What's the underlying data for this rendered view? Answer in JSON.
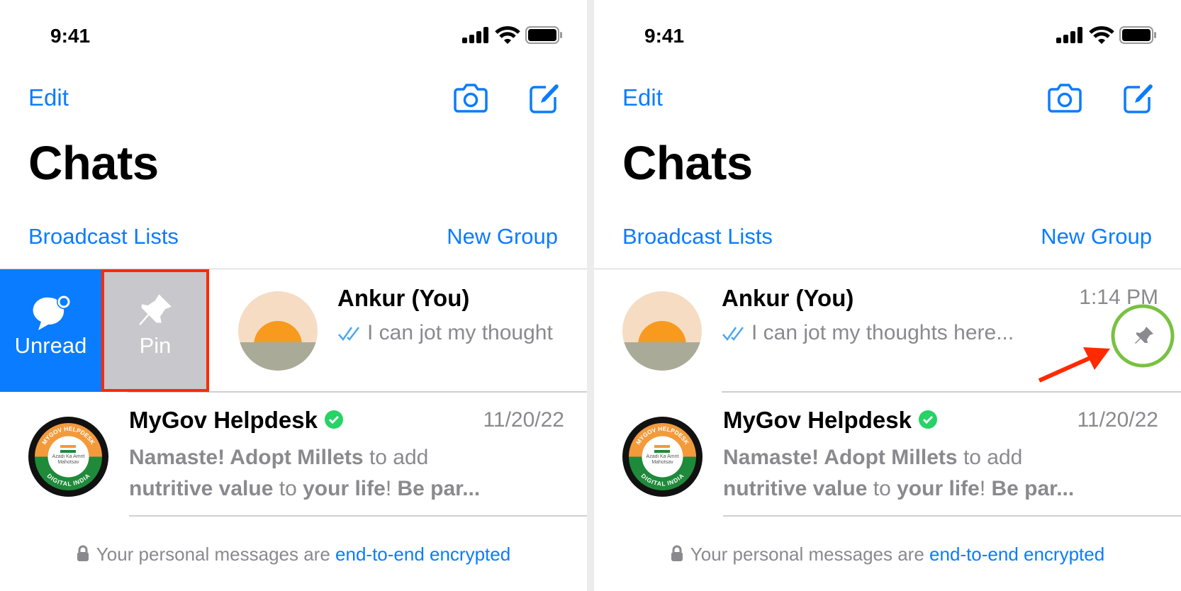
{
  "panels": [
    {
      "status": {
        "time": "9:41"
      },
      "header": {
        "edit_label": "Edit",
        "title": "Chats",
        "broadcast_label": "Broadcast Lists",
        "new_group_label": "New Group"
      },
      "swipe_actions": {
        "unread_label": "Unread",
        "pin_label": "Pin"
      },
      "chats": [
        {
          "name": "Ankur (You)",
          "message": "I can jot my thought",
          "time": ""
        },
        {
          "name": "MyGov Helpdesk",
          "time": "11/20/22",
          "message_parts": [
            "Namaste! Adopt Millets",
            " to add ",
            "nutritive value",
            " to ",
            "your life",
            "! ",
            "Be par..."
          ]
        }
      ],
      "footer": {
        "text": "Your personal messages are ",
        "link": "end-to-end encrypted"
      }
    },
    {
      "status": {
        "time": "9:41"
      },
      "header": {
        "edit_label": "Edit",
        "title": "Chats",
        "broadcast_label": "Broadcast Lists",
        "new_group_label": "New Group"
      },
      "chats": [
        {
          "name": "Ankur (You)",
          "message": "I can jot my thoughts here...",
          "time": "1:14 PM",
          "pinned": true
        },
        {
          "name": "MyGov Helpdesk",
          "time": "11/20/22",
          "message_parts": [
            "Namaste! Adopt Millets",
            " to add ",
            "nutritive value",
            " to ",
            "your life",
            "! ",
            "Be par..."
          ]
        }
      ],
      "footer": {
        "text": "Your personal messages are ",
        "link": "end-to-end encrypted"
      }
    }
  ],
  "colors": {
    "accent": "#0a7cff",
    "unread_action": "#0a7cff",
    "pin_action": "#c7c7cc",
    "highlight_box": "#ff2a00",
    "highlight_circle": "#7ac143",
    "arrow": "#ff2a00",
    "verified": "#25d366"
  },
  "avatar_logo_text": [
    "MYGOV HELPDESK",
    "Azadi Ka Amrit Mahotsav",
    "DIGITAL INDIA"
  ]
}
